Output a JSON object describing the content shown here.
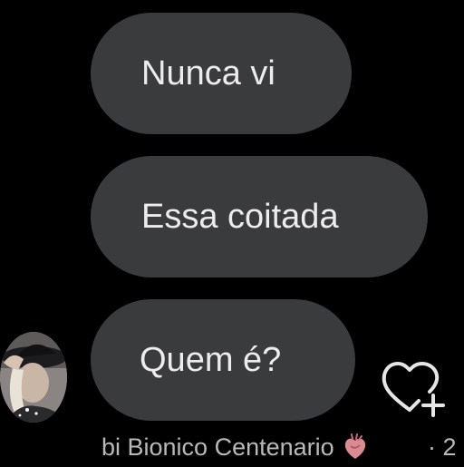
{
  "messages": [
    {
      "text": "Nunca vi"
    },
    {
      "text": "Essa coitada"
    },
    {
      "text": "Quem é?"
    }
  ],
  "reply_meta": {
    "author": "bi Bionico Centenario",
    "separator_time": "· 2"
  },
  "icons": {
    "avatar": "profile-photo",
    "react": "heart-plus-icon",
    "author_emoji": "anatomical-heart-icon"
  },
  "colors": {
    "background": "#000000",
    "bubble": "#3a3b3d",
    "bubble_text": "#ececec",
    "meta_text": "#b9b9b9"
  }
}
